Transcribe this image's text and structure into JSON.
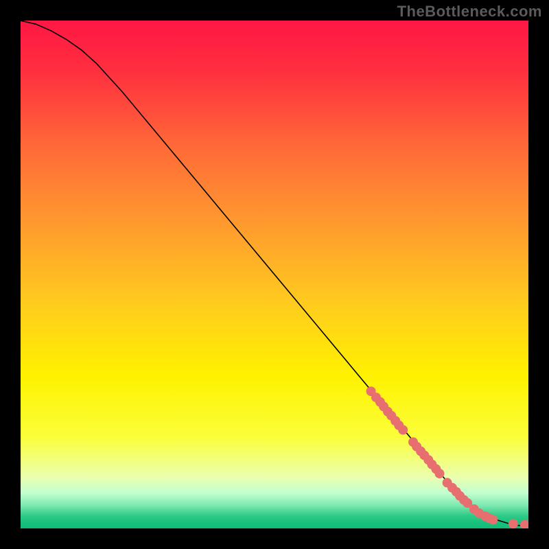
{
  "attribution": "TheBottleneck.com",
  "chart_data": {
    "type": "line",
    "title": "",
    "xlabel": "",
    "ylabel": "",
    "xlim": [
      0,
      100
    ],
    "ylim": [
      0,
      100
    ],
    "grid": false,
    "series": [
      {
        "name": "curve",
        "kind": "line",
        "color": "#000000",
        "x": [
          0,
          3,
          6,
          9,
          12,
          15,
          20,
          25,
          30,
          35,
          40,
          45,
          50,
          55,
          60,
          65,
          70,
          75,
          80,
          85,
          88,
          90,
          92,
          94,
          96,
          98,
          100
        ],
        "y": [
          100,
          99.3,
          98.0,
          96.3,
          94.2,
          91.5,
          86.0,
          80.0,
          74.0,
          68.0,
          62.0,
          56.0,
          50.0,
          44.0,
          38.0,
          32.0,
          26.0,
          20.0,
          14.0,
          8.0,
          5.0,
          3.5,
          2.4,
          1.6,
          1.0,
          0.6,
          0.4
        ]
      },
      {
        "name": "markers",
        "kind": "scatter",
        "color": "#e76f6f",
        "radius": 7,
        "points": [
          {
            "x": 69.0,
            "y": 27.0
          },
          {
            "x": 70.0,
            "y": 25.8
          },
          {
            "x": 70.8,
            "y": 24.9
          },
          {
            "x": 71.5,
            "y": 24.0
          },
          {
            "x": 72.3,
            "y": 23.0
          },
          {
            "x": 73.0,
            "y": 22.2
          },
          {
            "x": 73.8,
            "y": 21.2
          },
          {
            "x": 74.5,
            "y": 20.3
          },
          {
            "x": 75.3,
            "y": 19.4
          },
          {
            "x": 77.3,
            "y": 17.0
          },
          {
            "x": 78.0,
            "y": 16.1
          },
          {
            "x": 78.8,
            "y": 15.2
          },
          {
            "x": 79.5,
            "y": 14.4
          },
          {
            "x": 80.3,
            "y": 13.5
          },
          {
            "x": 81.0,
            "y": 12.6
          },
          {
            "x": 81.8,
            "y": 11.7
          },
          {
            "x": 82.5,
            "y": 10.8
          },
          {
            "x": 84.0,
            "y": 9.0
          },
          {
            "x": 85.0,
            "y": 8.0
          },
          {
            "x": 85.8,
            "y": 7.2
          },
          {
            "x": 86.5,
            "y": 6.4
          },
          {
            "x": 87.3,
            "y": 5.6
          },
          {
            "x": 88.0,
            "y": 5.0
          },
          {
            "x": 89.3,
            "y": 3.8
          },
          {
            "x": 90.3,
            "y": 3.0
          },
          {
            "x": 91.5,
            "y": 2.4
          },
          {
            "x": 92.3,
            "y": 2.0
          },
          {
            "x": 93.0,
            "y": 1.7
          },
          {
            "x": 97.0,
            "y": 0.9
          },
          {
            "x": 99.3,
            "y": 0.7
          },
          {
            "x": 100.0,
            "y": 0.6
          }
        ]
      }
    ],
    "background_gradient_stops": [
      {
        "offset": 0.0,
        "color": "#ff1744"
      },
      {
        "offset": 0.1,
        "color": "#ff2f3f"
      },
      {
        "offset": 0.25,
        "color": "#ff6a38"
      },
      {
        "offset": 0.4,
        "color": "#ff9a2e"
      },
      {
        "offset": 0.55,
        "color": "#ffc91f"
      },
      {
        "offset": 0.7,
        "color": "#fff200"
      },
      {
        "offset": 0.82,
        "color": "#fbff3a"
      },
      {
        "offset": 0.9,
        "color": "#eaffb0"
      },
      {
        "offset": 0.93,
        "color": "#c3ffd0"
      },
      {
        "offset": 0.955,
        "color": "#7de8af"
      },
      {
        "offset": 0.975,
        "color": "#2fca87"
      },
      {
        "offset": 0.99,
        "color": "#16c07c"
      },
      {
        "offset": 1.0,
        "color": "#0fbd77"
      }
    ]
  }
}
